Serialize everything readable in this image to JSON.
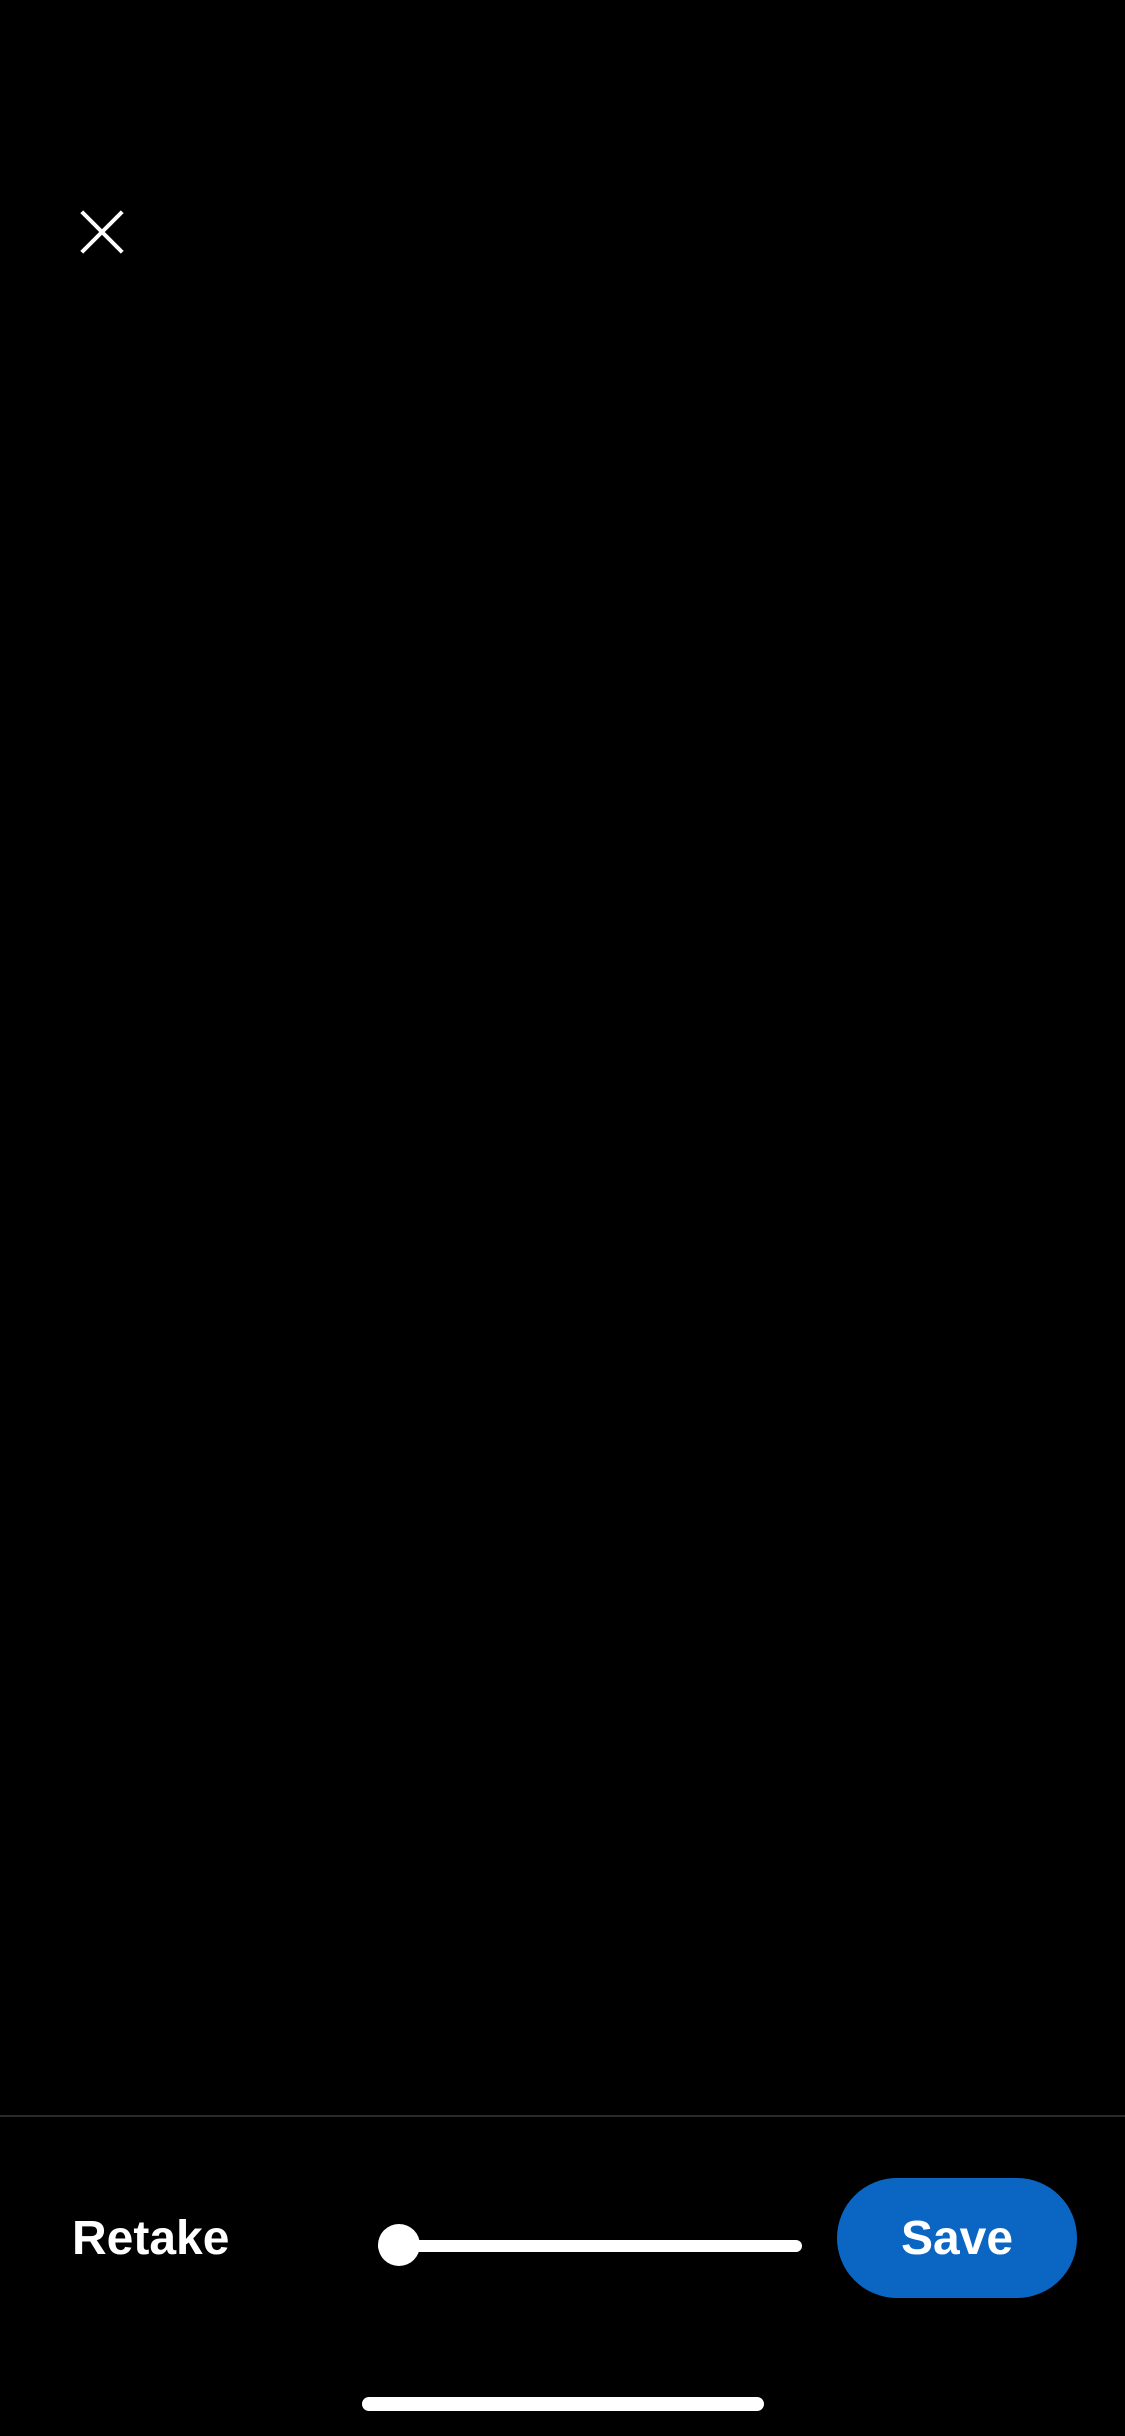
{
  "colors": {
    "background": "#000000",
    "accent": "#0a66c2",
    "foreground": "#ffffff",
    "divider": "#2a2a2a"
  },
  "header": {
    "close_icon": "close-icon"
  },
  "toolbar": {
    "retake_label": "Retake",
    "save_label": "Save",
    "slider": {
      "value": 0.05
    }
  }
}
